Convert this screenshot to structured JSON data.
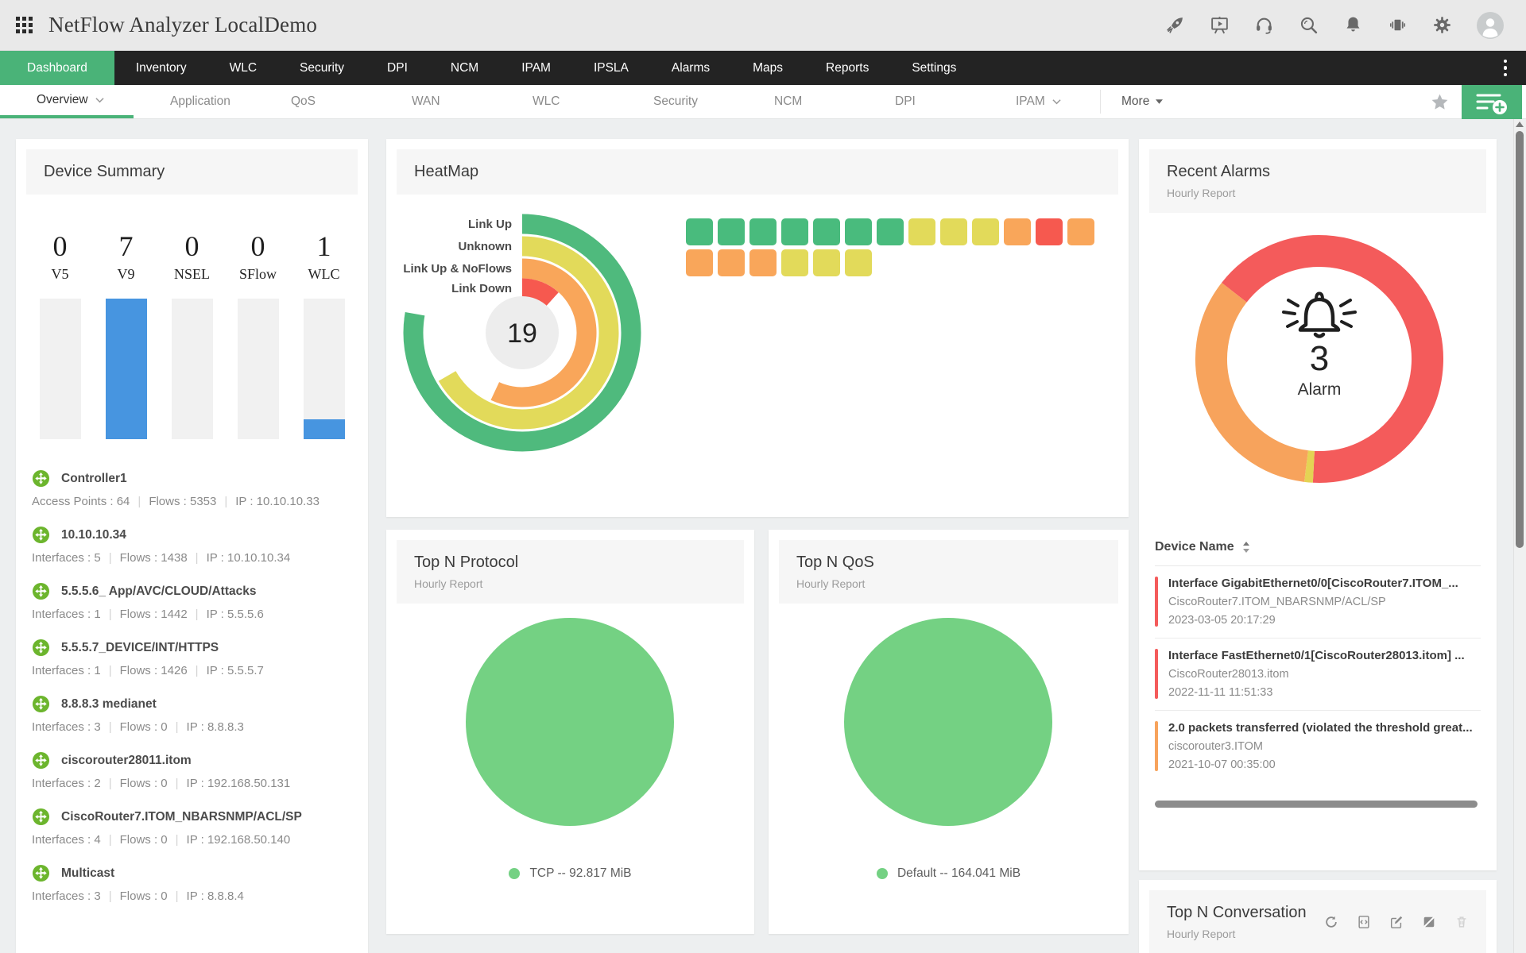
{
  "topbar": {
    "title": "NetFlow Analyzer LocalDemo",
    "icons": [
      "apps-grid-icon",
      "rocket-icon",
      "presentation-icon",
      "headset-icon",
      "search-icon",
      "bell-icon",
      "carousel-icon",
      "gear-icon",
      "avatar"
    ]
  },
  "navbar": {
    "items": [
      {
        "label": "Dashboard",
        "active": true
      },
      {
        "label": "Inventory"
      },
      {
        "label": "WLC"
      },
      {
        "label": "Security"
      },
      {
        "label": "DPI"
      },
      {
        "label": "NCM"
      },
      {
        "label": "IPAM"
      },
      {
        "label": "IPSLA"
      },
      {
        "label": "Alarms"
      },
      {
        "label": "Maps"
      },
      {
        "label": "Reports"
      },
      {
        "label": "Settings"
      }
    ]
  },
  "subnav": {
    "items": [
      {
        "label": "Overview",
        "active": true,
        "chevron": true
      },
      {
        "label": "Application"
      },
      {
        "label": "QoS"
      },
      {
        "label": "WAN"
      },
      {
        "label": "WLC"
      },
      {
        "label": "Security"
      },
      {
        "label": "NCM"
      },
      {
        "label": "DPI"
      },
      {
        "label": "IPAM",
        "chevron": true
      }
    ],
    "more_label": "More"
  },
  "device_summary": {
    "title": "Device Summary",
    "stats": [
      {
        "value": "0",
        "label": "V5"
      },
      {
        "value": "7",
        "label": "V9"
      },
      {
        "value": "0",
        "label": "NSEL"
      },
      {
        "value": "0",
        "label": "SFlow"
      },
      {
        "value": "1",
        "label": "WLC"
      }
    ],
    "devices": [
      {
        "name": "Controller1",
        "stats": [
          "Access Points : 64",
          "Flows : 5353",
          "IP : 10.10.10.33"
        ]
      },
      {
        "name": "10.10.10.34",
        "stats": [
          "Interfaces : 5",
          "Flows : 1438",
          "IP : 10.10.10.34"
        ]
      },
      {
        "name": "5.5.5.6_ App/AVC/CLOUD/Attacks",
        "stats": [
          "Interfaces : 1",
          "Flows : 1442",
          "IP : 5.5.5.6"
        ]
      },
      {
        "name": "5.5.5.7_DEVICE/INT/HTTPS",
        "stats": [
          "Interfaces : 1",
          "Flows : 1426",
          "IP : 5.5.5.7"
        ]
      },
      {
        "name": "8.8.8.3 medianet",
        "stats": [
          "Interfaces : 3",
          "Flows : 0",
          "IP : 8.8.8.3"
        ]
      },
      {
        "name": "ciscorouter28011.itom",
        "stats": [
          "Interfaces : 2",
          "Flows : 0",
          "IP : 192.168.50.131"
        ]
      },
      {
        "name": "CiscoRouter7.ITOM_NBARSNMP/ACL/SP",
        "stats": [
          "Interfaces : 4",
          "Flows : 0",
          "IP : 192.168.50.140"
        ]
      },
      {
        "name": "Multicast",
        "stats": [
          "Interfaces : 3",
          "Flows : 0",
          "IP : 8.8.8.4"
        ]
      }
    ]
  },
  "heatmap": {
    "title": "HeatMap"
  },
  "top_n_protocol": {
    "title": "Top N Protocol",
    "subtitle": "Hourly Report",
    "legend": "TCP -- 92.817 MiB"
  },
  "top_n_qos": {
    "title": "Top N QoS",
    "subtitle": "Hourly Report",
    "legend": "Default -- 164.041 MiB"
  },
  "recent_alarms": {
    "title": "Recent Alarms",
    "subtitle": "Hourly Report",
    "center_value": "3",
    "center_label": "Alarm",
    "table_header": "Device Name",
    "alarms": [
      {
        "severity": "critical",
        "message": "Interface GigabitEthernet0/0[CiscoRouter7.ITOM_...",
        "device": "CiscoRouter7.ITOM_NBARSNMP/ACL/SP",
        "time": "2023-03-05 20:17:29"
      },
      {
        "severity": "critical",
        "message": "Interface FastEthernet0/1[CiscoRouter28013.itom] ...",
        "device": "CiscoRouter28013.itom",
        "time": "2022-11-11 11:51:33"
      },
      {
        "severity": "trouble",
        "message": "2.0 packets transferred (violated the threshold great...",
        "device": "ciscorouter3.ITOM",
        "time": "2021-10-07 00:35:00"
      }
    ]
  },
  "top_n_conversation": {
    "title": "Top N Conversation",
    "subtitle": "Hourly Report",
    "icons": [
      "refresh-icon",
      "embed-icon",
      "edit-icon",
      "contrast-icon",
      "delete-icon"
    ]
  },
  "colors": {
    "accent_green": "#4ab378",
    "bar_blue": "#4795e0",
    "pie_green": "#74d183",
    "critical_red": "#f45b5b",
    "trouble_orange": "#f7a35c",
    "attention_yellow": "#e4d354",
    "device_icon_green": "#6cb52d"
  },
  "chart_data": [
    {
      "type": "bar",
      "title": "Device Summary",
      "categories": [
        "V5",
        "V9",
        "NSEL",
        "SFlow",
        "WLC"
      ],
      "values": [
        0,
        7,
        0,
        0,
        1
      ],
      "ylim": [
        0,
        7
      ],
      "bar_color": "#4795e0",
      "track_color": "#f1f1f1"
    },
    {
      "type": "radial_gauge",
      "title": "HeatMap",
      "center_value": "19",
      "series": [
        {
          "name": "Link Up",
          "value": 7,
          "sweep_deg": 280,
          "color": "#4fba7d"
        },
        {
          "name": "Unknown",
          "value": 6,
          "sweep_deg": 240,
          "color": "#e2da5a"
        },
        {
          "name": "Link Up & NoFlows",
          "value": 5,
          "sweep_deg": 205,
          "color": "#f9a65a"
        },
        {
          "name": "Link Down",
          "value": 1,
          "sweep_deg": 42,
          "color": "#f6594f"
        }
      ]
    },
    {
      "type": "heatmap",
      "title": "Interface Status Grid",
      "status_colors": {
        "up": "#49bb7d",
        "unknown": "#e2da5a",
        "noflows": "#f9a65a",
        "down": "#f6594f"
      },
      "rows": [
        [
          "up",
          "up",
          "up",
          "up",
          "up",
          "up",
          "up",
          "unknown",
          "unknown",
          "unknown",
          "noflows",
          "down",
          "noflows"
        ],
        [
          "noflows",
          "noflows",
          "noflows",
          "unknown",
          "unknown",
          "unknown"
        ]
      ]
    },
    {
      "type": "pie",
      "title": "Top N Protocol",
      "labels": [
        "TCP"
      ],
      "values": [
        92.817
      ],
      "unit": "MiB",
      "colors": [
        "#74d183"
      ],
      "legend_position": "bottom"
    },
    {
      "type": "pie",
      "title": "Top N QoS",
      "labels": [
        "Default"
      ],
      "values": [
        164.041
      ],
      "unit": "MiB",
      "colors": [
        "#74d183"
      ],
      "legend_position": "bottom"
    },
    {
      "type": "donut",
      "title": "Recent Alarms",
      "center_value": "3",
      "center_label": "Alarm",
      "segments": [
        {
          "name": "critical",
          "count": 2,
          "start_deg": 308,
          "sweep_deg": 235,
          "color": "#f45b5b"
        },
        {
          "name": "attention",
          "count": 0,
          "start_deg": 183,
          "sweep_deg": 4,
          "color": "#e4d354"
        },
        {
          "name": "trouble",
          "count": 1,
          "start_deg": 187,
          "sweep_deg": 121,
          "color": "#f7a35c"
        }
      ]
    }
  ]
}
